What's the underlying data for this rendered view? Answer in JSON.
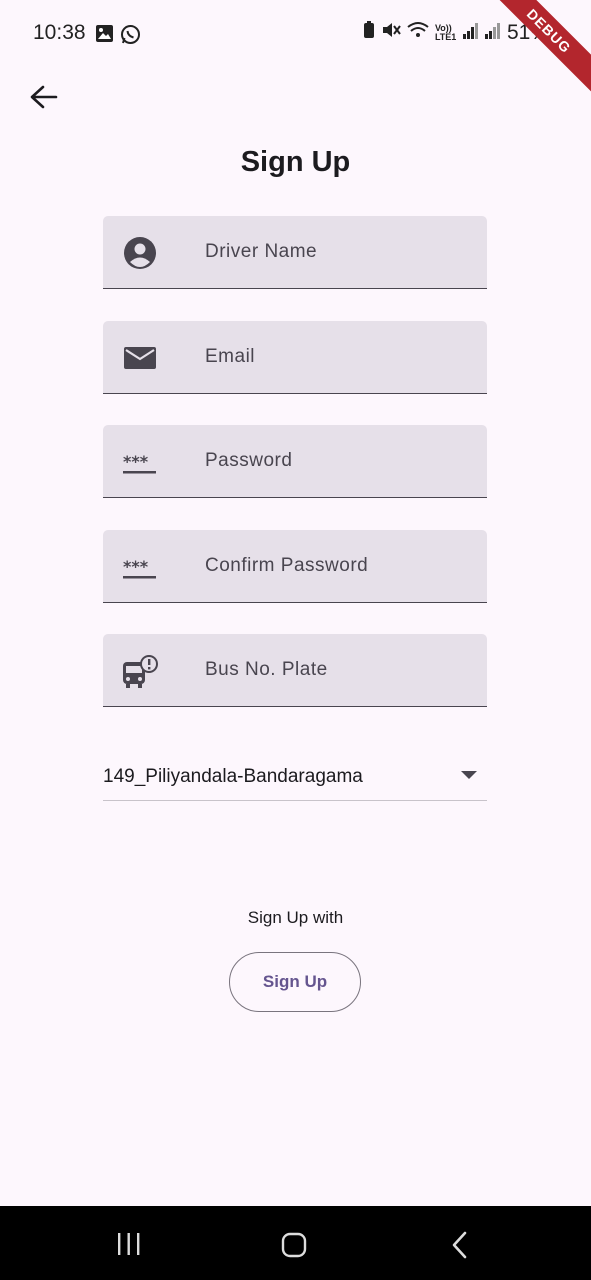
{
  "status_bar": {
    "time": "10:38",
    "battery": "51%",
    "debug_banner": "DEBUG",
    "network_label": "Vo)) LTE1"
  },
  "header": {
    "title": "Sign Up"
  },
  "form": {
    "fields": [
      {
        "label": "Driver Name",
        "icon": "account-circle-icon"
      },
      {
        "label": "Email",
        "icon": "email-icon"
      },
      {
        "label": "Password",
        "icon": "password-icon"
      },
      {
        "label": "Confirm Password",
        "icon": "password-icon"
      },
      {
        "label": "Bus No. Plate",
        "icon": "bus-alert-icon"
      }
    ],
    "route_dropdown": {
      "selected": "149_Piliyandala-Bandaragama"
    }
  },
  "actions": {
    "signup_with_label": "Sign Up with",
    "signup_button": "Sign Up"
  },
  "colors": {
    "background": "#fdf7fd",
    "field_fill": "#e6e0e9",
    "accent": "#65558f",
    "debug": "#b3262d"
  }
}
